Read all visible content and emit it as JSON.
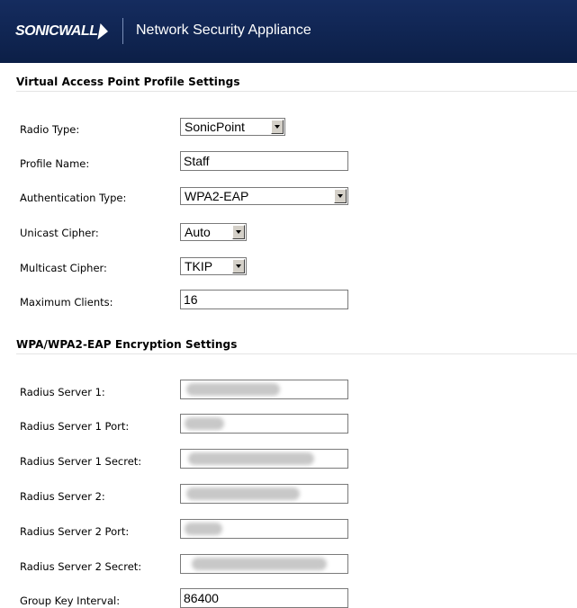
{
  "header": {
    "logo_text": "SONICWALL",
    "title": "Network Security Appliance"
  },
  "profile_section": {
    "title": "Virtual Access Point Profile Settings",
    "radio_type": {
      "label": "Radio Type:",
      "value": "SonicPoint"
    },
    "profile_name": {
      "label": "Profile Name:",
      "value": "Staff"
    },
    "auth_type": {
      "label": "Authentication Type:",
      "value": "WPA2-EAP"
    },
    "unicast_cipher": {
      "label": "Unicast Cipher:",
      "value": "Auto"
    },
    "multicast_cipher": {
      "label": "Multicast Cipher:",
      "value": "TKIP"
    },
    "max_clients": {
      "label": "Maximum Clients:",
      "value": "16"
    }
  },
  "encryption_section": {
    "title": "WPA/WPA2-EAP Encryption Settings",
    "radius1": {
      "label": "Radius Server 1:",
      "value": ""
    },
    "radius1_port": {
      "label": "Radius Server 1 Port:",
      "value": ""
    },
    "radius1_secret": {
      "label": "Radius Server 1 Secret:",
      "value": ""
    },
    "radius2": {
      "label": "Radius Server 2:",
      "value": ""
    },
    "radius2_port": {
      "label": "Radius Server 2 Port:",
      "value": ""
    },
    "radius2_secret": {
      "label": "Radius Server 2 Secret:",
      "value": ""
    },
    "group_key_interval": {
      "label": "Group Key Interval:",
      "value": "86400"
    }
  }
}
